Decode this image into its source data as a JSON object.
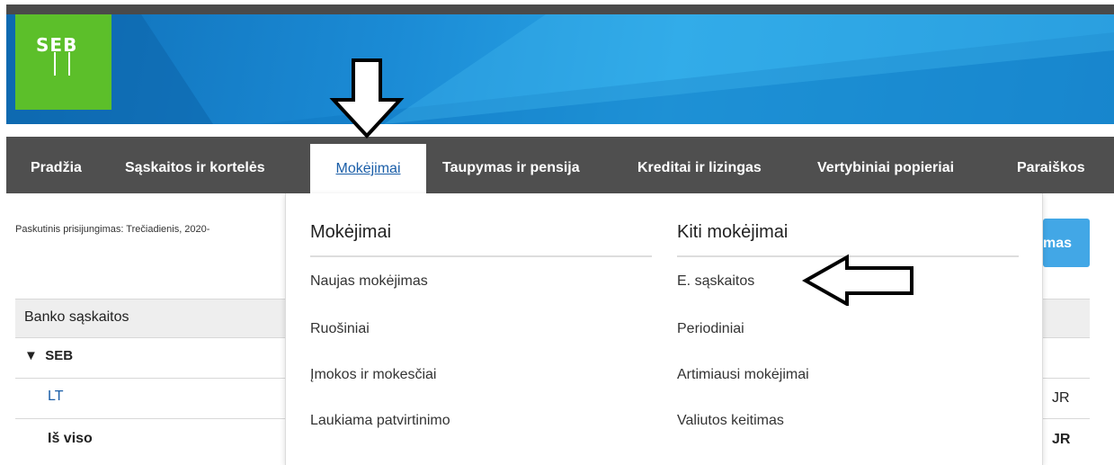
{
  "brand": {
    "logo_text": "SEB",
    "logo_color": "#5cbf2a",
    "banner_color": "#1b8bd5"
  },
  "nav": {
    "items": [
      {
        "label": "Pradžia"
      },
      {
        "label": "Sąskaitos ir kortelės"
      },
      {
        "label": "Mokėjimai",
        "active": true
      },
      {
        "label": "Taupymas ir pensija"
      },
      {
        "label": "Kreditai ir lizingas"
      },
      {
        "label": "Vertybiniai popieriai"
      },
      {
        "label": "Paraiškos"
      }
    ]
  },
  "last_login": "Paskutinis prisijungimas: Trečiadienis, 2020-",
  "right_button_label": "mas",
  "accounts": {
    "header": "Banko sąskaitos",
    "group": "SEB",
    "row_label": "LT",
    "row_amount_suffix": "JR",
    "total_label": "Iš viso",
    "total_amount_suffix": "JR"
  },
  "dropdown": {
    "column1": {
      "heading": "Mokėjimai",
      "links": [
        "Naujas mokėjimas",
        "Ruošiniai",
        "Įmokos ir mokesčiai",
        "Laukiama patvirtinimo"
      ]
    },
    "column2": {
      "heading": "Kiti mokėjimai",
      "links": [
        "E. sąskaitos",
        "Periodiniai",
        "Artimiausi mokėjimai",
        "Valiutos keitimas"
      ]
    }
  },
  "annotations": {
    "down_arrow_icon": "down-arrow-icon",
    "left_arrow_icon": "left-arrow-icon"
  },
  "colors": {
    "nav_bg": "#4f4f4f",
    "link_blue": "#1a5ea8",
    "button_blue": "#42a7e6"
  }
}
